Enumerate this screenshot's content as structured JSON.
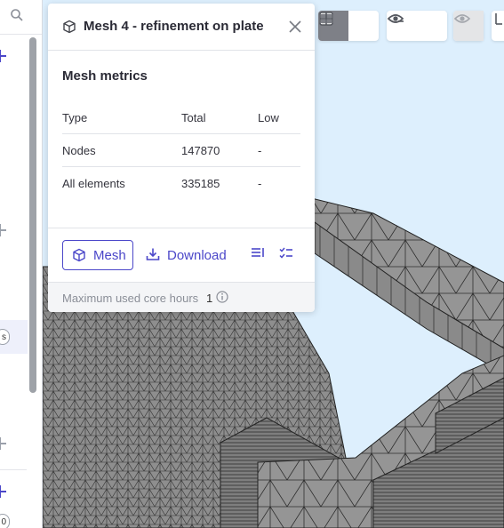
{
  "sidebar": {
    "pill_1": "s",
    "pill_2": "0"
  },
  "panel": {
    "title": "Mesh 4 - refinement on plate",
    "metrics_title": "Mesh metrics",
    "columns": [
      "Type",
      "Total",
      "Low"
    ],
    "rows": [
      {
        "type": "Nodes",
        "total": "147870",
        "low": "-"
      },
      {
        "type": "All elements",
        "total": "335185",
        "low": "-"
      }
    ],
    "mesh_button": "Mesh",
    "download_button": "Download",
    "footer_text": "Maximum used core hours",
    "footer_value": "1"
  },
  "icons": {
    "cube": "cube-icon",
    "close": "close-icon",
    "download": "download-icon",
    "list": "list-icon",
    "checklist": "checklist-icon",
    "info": "info-icon",
    "search": "search-icon"
  },
  "colors": {
    "accent": "#4b47c9",
    "viewport_bg": "#ddeffd",
    "mesh_fill": "#8c8c8c",
    "toolbar_active": "#7e8087"
  }
}
